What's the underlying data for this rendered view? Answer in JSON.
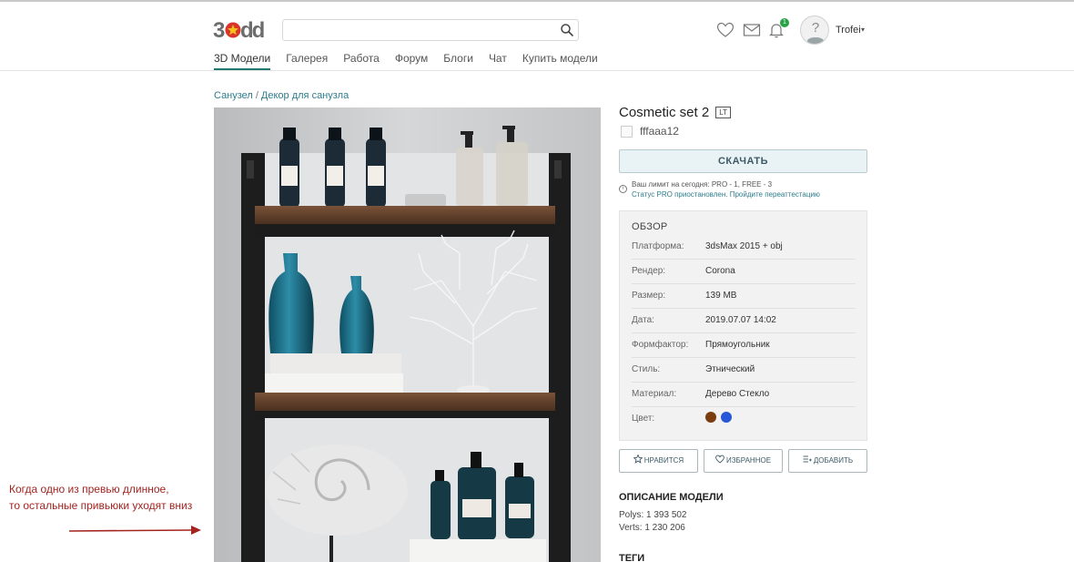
{
  "header": {
    "logo_text": "3ddd",
    "search": {
      "placeholder": "",
      "value": ""
    },
    "notifications_count": "1",
    "username": "Trofei",
    "nav": [
      {
        "label": "3D Модели",
        "active": true
      },
      {
        "label": "Галерея"
      },
      {
        "label": "Работа"
      },
      {
        "label": "Форум"
      },
      {
        "label": "Блоги"
      },
      {
        "label": "Чат"
      },
      {
        "label": "Купить модели"
      }
    ]
  },
  "breadcrumb": {
    "item1": "Санузел",
    "sep": "/",
    "item2": "Декор для санузла"
  },
  "annotation": {
    "line1": "Когда одно из превью длинное,",
    "line2": "то остальные привьюки уходят вниз",
    "color": "#a3231f"
  },
  "model": {
    "title": "Cosmetic set 2",
    "badge": "LT",
    "author": "fffaaa12",
    "download_label": "СКАЧАТЬ",
    "limit_text": "Ваш лимит на сегодня: PRO - 1, FREE - 3",
    "status_text": "Статус PRO приостановлен. Пройдите переаттестацию"
  },
  "overview": {
    "title": "ОБЗОР",
    "specs": [
      {
        "key": "Платформа:",
        "value": "3dsMax 2015 + obj"
      },
      {
        "key": "Рендер:",
        "value": "Corona"
      },
      {
        "key": "Размер:",
        "value": "139 MB"
      },
      {
        "key": "Дата:",
        "value": "2019.07.07 14:02"
      },
      {
        "key": "Формфактор:",
        "value": "Прямоугольник"
      },
      {
        "key": "Стиль:",
        "value": "Этнический"
      },
      {
        "key": "Материал:",
        "value": "Дерево Стекло"
      },
      {
        "key": "Цвет:",
        "value": ""
      }
    ],
    "colors": [
      "#7a3d10",
      "#2657d6"
    ]
  },
  "actions": {
    "like": "НРАВИТСЯ",
    "favorite": "ИЗБРАННОЕ",
    "add": "ДОБАВИТЬ"
  },
  "description": {
    "title": "ОПИСАНИЕ МОДЕЛИ",
    "polys": "Polys: 1 393 502",
    "verts": "Verts: 1 230 206"
  },
  "tags": {
    "title": "ТЕГИ"
  },
  "colors": {
    "accent": "#1f7a6f",
    "link": "#2e7d8c",
    "badge_green": "#27a244"
  }
}
